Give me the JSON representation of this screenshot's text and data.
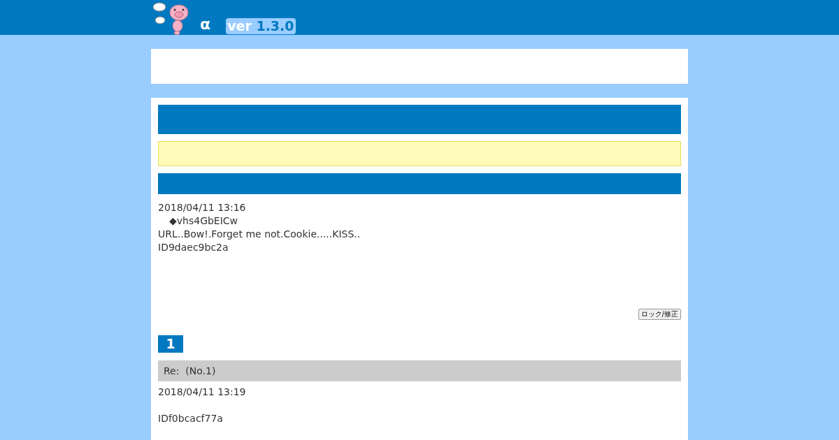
{
  "header": {
    "title": "α",
    "version_label": "ver",
    "version_number": "1.3.0"
  },
  "post": {
    "date": "2018/04/11 13:16",
    "trip": "◆vhs4GbEICw",
    "body": "URL..Bow!.Forget me not.Cookie.....KISS..",
    "id": "ID9daec9bc2a",
    "button": "ロック/修正"
  },
  "replies": [
    {
      "number": "1",
      "subject": "Re:  (No.1)",
      "date": "2018/04/11 13:19",
      "id": "IDf0bcacf77a"
    }
  ]
}
